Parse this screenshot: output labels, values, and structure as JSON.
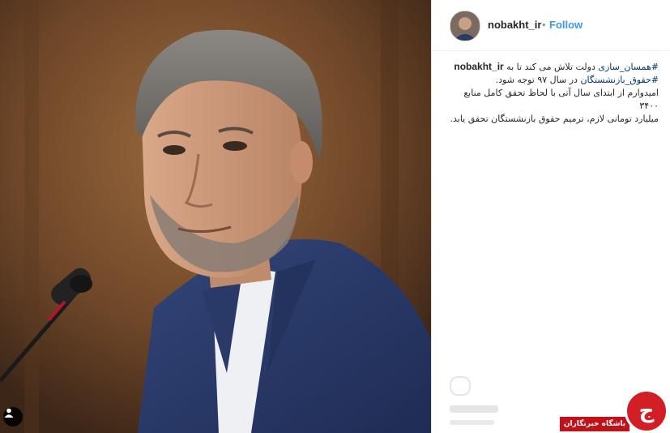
{
  "post": {
    "username": "nobakht_ir",
    "separator": "•",
    "follow_label": "Follow",
    "caption": {
      "user": "nobakht_ir",
      "hashtag1": "#همسان_سازی",
      "line1_text": " دولت تلاش می کند تا به",
      "hashtag2": "#حقوق_بازنشستگان",
      "line2_text": " در سال ۹۷ توجه شود.",
      "line3": "امیدوارم از ابتدای سال آتی با لحاظ تحقق کامل منابع ۳۴۰۰",
      "line4": "میلیارد تومانی لازم، ترمیم حقوق بازنشستگان تحقق یابد."
    }
  },
  "watermark": {
    "label": "باشگاه خبرنگاران",
    "glyph": "ج"
  },
  "colors": {
    "accent": "#3897f0",
    "watermark_red": "#d21f26"
  },
  "icons": [
    "user-tag-icon",
    "comment-icon"
  ]
}
